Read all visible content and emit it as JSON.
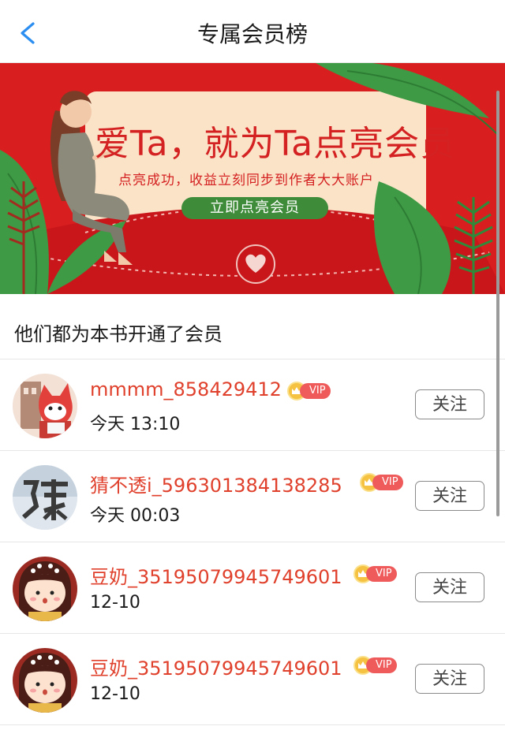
{
  "nav": {
    "title": "专属会员榜",
    "back_icon": "chevron-left-icon"
  },
  "banner": {
    "title": "爱Ta，就为Ta点亮会员",
    "subtitle": "点亮成功，收益立刻同步到作者大大账户",
    "button_label": "立即点亮会员",
    "colors": {
      "background": "#d81e1e",
      "card": "#fbe3c8",
      "button": "#3e8b3a"
    }
  },
  "section": {
    "title": "他们都为本书开通了会员"
  },
  "members": [
    {
      "name": "mmmm_858429412",
      "vip_label": "VIP",
      "time": "今天 13:10",
      "follow_label": "关注",
      "avatar_icon": "fox-avatar"
    },
    {
      "name": "猜不透i_596301384138285",
      "vip_label": "VIP",
      "time": "今天 00:03",
      "follow_label": "关注",
      "avatar_icon": "chen-character-avatar"
    },
    {
      "name": "豆奶_35195079945749601",
      "vip_label": "VIP",
      "time": "12-10",
      "follow_label": "关注",
      "avatar_icon": "cartoon-girl-avatar"
    },
    {
      "name": "豆奶_35195079945749601",
      "vip_label": "VIP",
      "time": "12-10",
      "follow_label": "关注",
      "avatar_icon": "cartoon-girl-avatar"
    }
  ],
  "colors": {
    "accent_name": "#e0412d",
    "vip_badge": "#ef5b5b",
    "crown": "#f5c242",
    "back_arrow": "#2b8ef0"
  }
}
